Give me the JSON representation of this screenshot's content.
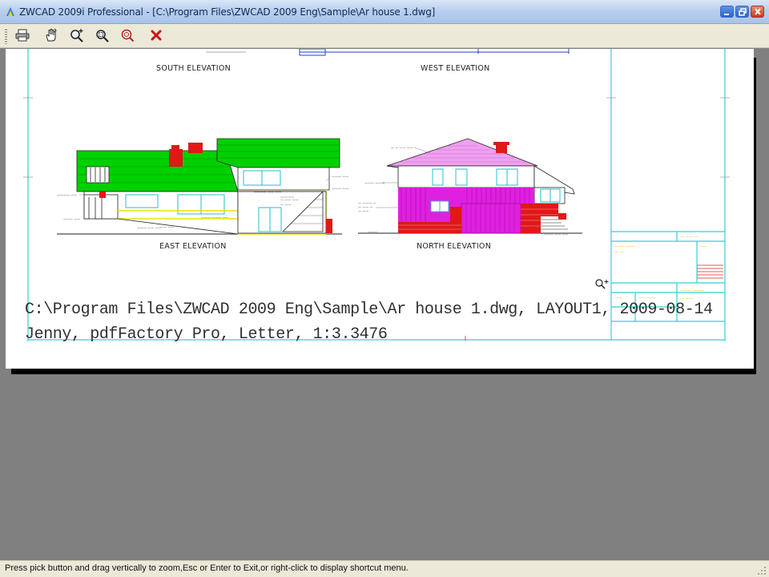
{
  "window": {
    "title": "ZWCAD 2009i Professional - [C:\\Program Files\\ZWCAD 2009 Eng\\Sample\\Ar house 1.dwg]"
  },
  "toolbar": {
    "buttons": [
      {
        "name": "print",
        "icon": "printer-icon"
      },
      {
        "name": "pan",
        "icon": "pan-hand-icon"
      },
      {
        "name": "zoom-realtime",
        "icon": "zoom-realtime-icon"
      },
      {
        "name": "zoom-window",
        "icon": "zoom-window-icon"
      },
      {
        "name": "zoom-original",
        "icon": "zoom-original-icon"
      },
      {
        "name": "close-preview",
        "icon": "close-x-icon"
      }
    ]
  },
  "drawing": {
    "labels": {
      "south": "SOUTH ELEVATION",
      "west": "WEST ELEVATION",
      "east": "EAST ELEVATION",
      "north": "NORTH ELEVATION"
    },
    "colors": {
      "frame": "#30d0d8",
      "green_roof": "#00d000",
      "brick_red": "#e01818",
      "magenta": "#e020e0",
      "pink_roof": "#f0a0f0",
      "yellow": "#f0e000",
      "blue": "#2040d0"
    }
  },
  "print_info": {
    "line1": "C:\\Program Files\\ZWCAD 2009 Eng\\Sample\\Ar house 1.dwg, LAYOUT1, 2009-08-14",
    "line2": "Jenny, pdfFactory Pro, Letter, 1:3.3476"
  },
  "status": {
    "prompt": "Press pick button and drag vertically to zoom,Esc or Enter to Exit,or right-click to display shortcut menu."
  }
}
